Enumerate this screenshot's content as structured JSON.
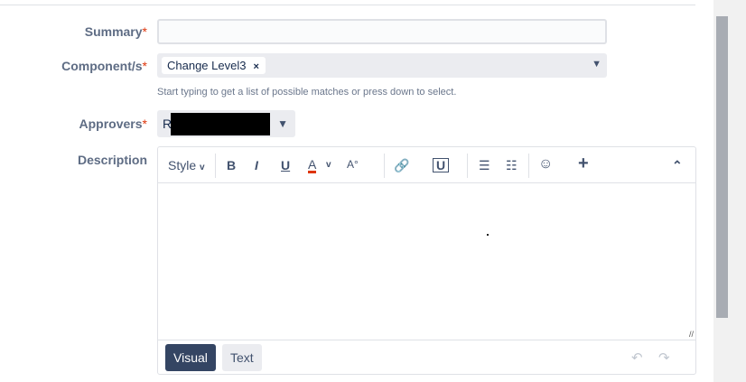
{
  "form": {
    "summary": {
      "label": "Summary",
      "required": "*",
      "value": ""
    },
    "components": {
      "label": "Component/s",
      "required": "*",
      "chips": [
        "Change Level3"
      ],
      "remove": "×",
      "help": "Start typing to get a list of possible matches or press down to select."
    },
    "approvers": {
      "label": "Approvers",
      "required": "*",
      "value_visible": "R"
    },
    "description": {
      "label": "Description",
      "toolbar": {
        "style": "Style",
        "bold": "B",
        "italic": "I",
        "underline": "U",
        "color": "A",
        "more_format": "A°",
        "link": "🔗",
        "attach": "U",
        "bullets": "☰",
        "numbers": "☷",
        "emoji": "☺",
        "insert": "+",
        "collapse": "⌃",
        "chev": "⌄"
      },
      "modes": {
        "visual": "Visual",
        "text": "Text"
      },
      "undo": "↶",
      "redo": "↷"
    }
  }
}
